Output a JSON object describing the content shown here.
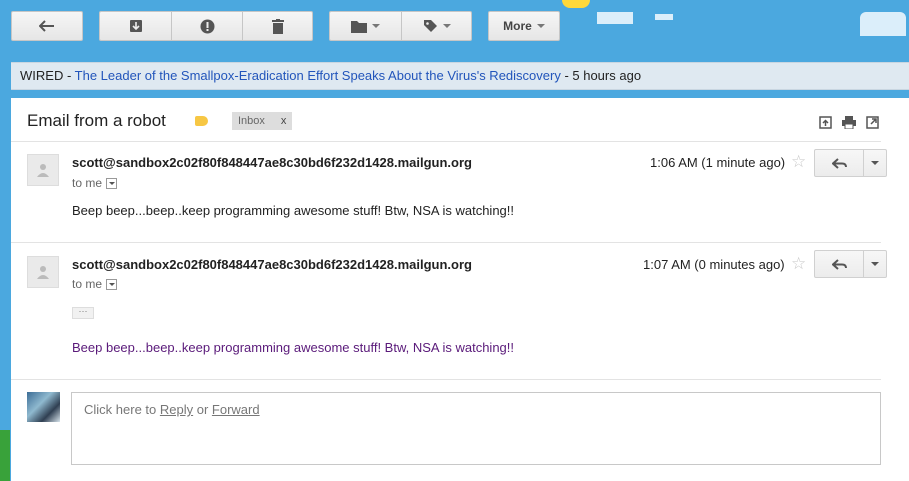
{
  "toolbar": {
    "back_icon": "back-arrow-icon",
    "archive_icon": "archive-icon",
    "spam_icon": "report-spam-icon",
    "delete_icon": "trash-icon",
    "move_icon": "folder-icon",
    "labels_icon": "label-tag-icon",
    "more_label": "More"
  },
  "news": {
    "source": "WIRED",
    "separator": " - ",
    "headline": "The Leader of the Smallpox-Eradication Effort Speaks About the Virus's Rediscovery",
    "time": " - 5 hours ago"
  },
  "thread": {
    "subject": "Email from a robot",
    "label": "Inbox",
    "label_remove": "x",
    "top_icons": [
      "expand-all-icon",
      "print-icon",
      "new-window-icon"
    ]
  },
  "messages": [
    {
      "sender": "scott@sandbox2c02f80f848447ae8c30bd6f232d1428.mailgun.org",
      "to": "to me",
      "time": "1:06 AM (1 minute ago)",
      "body": "Beep beep...beep..keep programming awesome stuff! Btw, NSA is watching!!"
    },
    {
      "sender": "scott@sandbox2c02f80f848447ae8c30bd6f232d1428.mailgun.org",
      "to": "to me",
      "time": "1:07 AM (0 minutes ago)",
      "show_trimmed": "···",
      "body": "Beep beep...beep..keep programming awesome stuff! Btw, NSA is watching!!"
    }
  ],
  "reply": {
    "prefix": "Click here to ",
    "reply_link": "Reply",
    "or": " or ",
    "forward_link": "Forward"
  },
  "colors": {
    "background_sky": "#4ba8df",
    "link": "#2255bb",
    "trimmed_body": "#5a1a7a",
    "label_tag": "#f7c744"
  }
}
